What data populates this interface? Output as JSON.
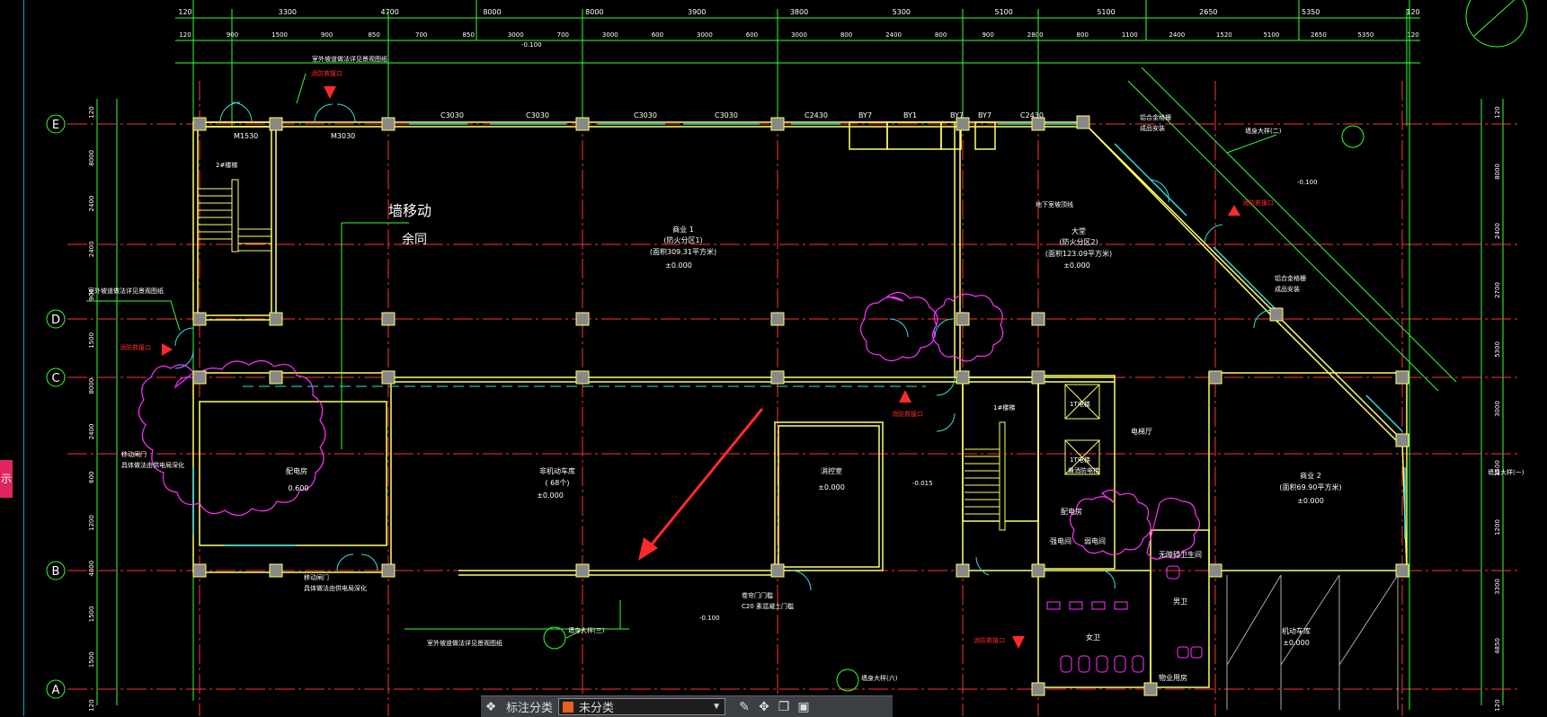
{
  "colors": {
    "grid_axis": "#ff3333",
    "wall": "#ffff66",
    "dim": "#33ff33",
    "window": "#33e0e0",
    "cloud": "#ff33ff",
    "column": "#888888",
    "text": "#ffffff",
    "arrow": "#ff2a2a"
  },
  "axes": [
    "E",
    "D",
    "C",
    "B",
    "A"
  ],
  "top_dims_row1": [
    "120",
    "3300",
    "4700",
    "8000",
    "8000",
    "3900",
    "3800",
    "5300",
    "5100",
    "5100",
    "2650",
    "5350",
    "120"
  ],
  "top_dims_row2": [
    "120",
    "900",
    "1500",
    "900",
    "850",
    "700",
    "850",
    "3000",
    "700",
    "3000",
    "600",
    "3000",
    "600",
    "3000",
    "800",
    "2400",
    "800",
    "900",
    "2800",
    "800",
    "1100",
    "2400",
    "1520",
    "5100",
    "2650",
    "5350",
    "120"
  ],
  "left_dims": [
    "120",
    "8000",
    "2400",
    "2400",
    "900",
    "1500",
    "8000",
    "2400",
    "600",
    "1200",
    "4800",
    "1500",
    "1500",
    "120"
  ],
  "right_dims": [
    "120",
    "8000",
    "2400",
    "2700",
    "5300",
    "3000",
    "1500",
    "1200",
    "3300",
    "4850",
    "120"
  ],
  "window_tags": [
    "M1530",
    "M3030",
    "C3030",
    "C3030",
    "C3030",
    "C3030",
    "C2430",
    "BY7",
    "BY1",
    "BY7",
    "BY7",
    "C2430"
  ],
  "rooms": [
    {
      "name": "商业 1",
      "sub": "(防火分区1)",
      "area": "(面积309.31平方米)",
      "elev": "±0.000"
    },
    {
      "name": "大堂",
      "sub": "(防火分区2)",
      "area": "(面积123.09平方米)",
      "elev": "±0.000"
    },
    {
      "name": "非机动车库",
      "sub": "( 68个)",
      "area": "",
      "elev": "±0.000"
    },
    {
      "name": "消控室",
      "sub": "",
      "area": "",
      "elev": "±0.000"
    },
    {
      "name": "商业 2",
      "sub": "",
      "area": "(面积69.90平方米)",
      "elev": "±0.000"
    },
    {
      "name": "配电房",
      "sub": "",
      "area": "",
      "elev": "0.600"
    },
    {
      "name": "物业用房",
      "sub": "",
      "area": "",
      "elev": "±0.000"
    },
    {
      "name": "女卫",
      "sub": "",
      "area": "",
      "elev": ""
    },
    {
      "name": "男卫",
      "sub": "",
      "area": "",
      "elev": ""
    },
    {
      "name": "无障碍卫生间",
      "sub": "",
      "area": "",
      "elev": ""
    },
    {
      "name": "强电间",
      "sub": "",
      "area": "",
      "elev": ""
    },
    {
      "name": "弱电间",
      "sub": "",
      "area": "",
      "elev": ""
    },
    {
      "name": "电梯厅",
      "sub": "",
      "area": "",
      "elev": ""
    }
  ],
  "notes": {
    "wall_move": "墙移动",
    "same": "余同",
    "stair_2": "2#楼梯",
    "stair_1": "1#楼梯",
    "elevator": "1T电梯",
    "elevator2": "1T电梯",
    "fire_lift": "兼消防电梯",
    "slope_note_top": "室外坡道做法详见景观图纸",
    "slope_note_left": "室外坡道做法详见景观图纸",
    "slope_note_bottom": "室外坡道做法详见景观图纸",
    "fire_entrance": "消防救援口",
    "move_door_1": "移动闸门",
    "move_door_2": "具体做法由供电局深化",
    "move_door_3": "移动闸门",
    "move_door_4": "具体做法由供电局深化",
    "detail_3": "墙身大样(三)",
    "detail_2": "墙身大样(二)",
    "detail_1": "墙身大样(一)",
    "detail_6": "墙身大样(六)",
    "underground_slope": "地下室坡顶线",
    "roller": "卷帘门门槛",
    "curb": "C20 素混凝土门槛",
    "elev_m0100": "-0.100",
    "elev_m0015": "-0.015",
    "elev_m0100b": "-0.100",
    "elev_m0100c": "-0.100",
    "arch_note": "铝合金格栅",
    "arch_note2": "成品安装",
    "lower_room": "机动车库"
  },
  "toolbar": {
    "label": "标注分类",
    "selected": "未分类",
    "side_tab": "示"
  }
}
